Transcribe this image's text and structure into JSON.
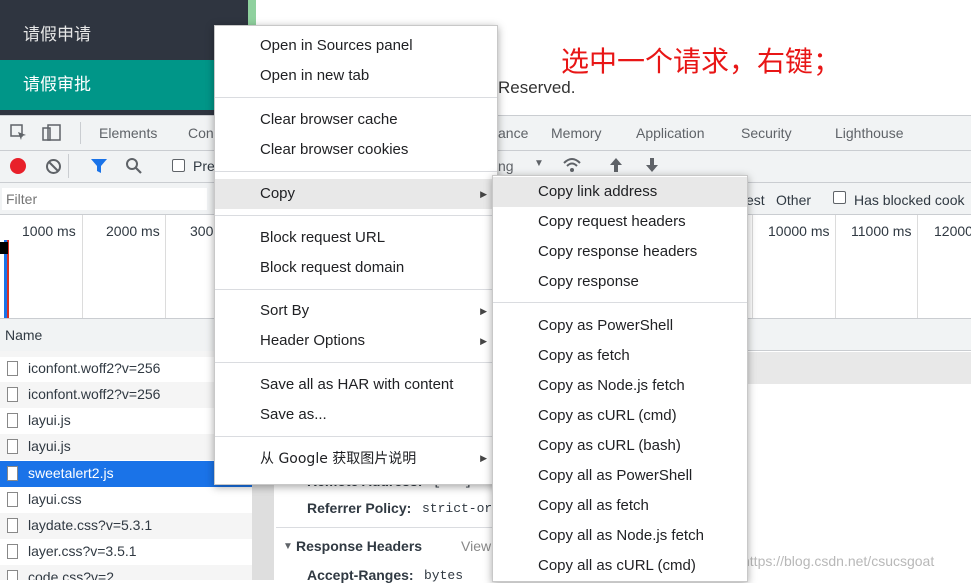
{
  "webpage": {
    "nav_items": [
      "请假申请",
      "请假审批"
    ],
    "footer_text": "Reserved.",
    "annotation": "选中一个请求，右键；"
  },
  "devtools": {
    "tabs": [
      "Elements",
      "Con",
      "ance",
      "Memory",
      "Application",
      "Security",
      "Lighthouse"
    ],
    "preserve_label": "Pre",
    "throttle_label": "ng",
    "filter_placeholder": "Filter",
    "filter_types": [
      "est",
      "Other"
    ],
    "blocked_label": "Has blocked cook",
    "timeline_ticks": [
      "1000 ms",
      "2000 ms",
      "300",
      "10000 ms",
      "11000 ms",
      "12000"
    ],
    "name_header": "Name",
    "requests": [
      {
        "name": "iconfont.woff2?v=256"
      },
      {
        "name": "iconfont.woff2?v=256"
      },
      {
        "name": "layui.js"
      },
      {
        "name": "layui.js"
      },
      {
        "name": "sweetalert2.js"
      },
      {
        "name": "layui.css"
      },
      {
        "name": "laydate.css?v=5.3.1"
      },
      {
        "name": "layer.css?v=3.5.1"
      },
      {
        "name": "code.css?v=2"
      }
    ],
    "detail": {
      "remote_address_label": "Remote Address:",
      "remote_address_value": "[::1]:8",
      "referrer_label": "Referrer Policy:",
      "referrer_value": "strict-or",
      "response_headers_label": "Response Headers",
      "view_label": "View",
      "accept_ranges_label": "Accept-Ranges:",
      "accept_ranges_value": "bytes"
    }
  },
  "context_menu": {
    "group1": [
      "Open in Sources panel",
      "Open in new tab"
    ],
    "group2": [
      "Clear browser cache",
      "Clear browser cookies"
    ],
    "copy": "Copy",
    "group3": [
      "Block request URL",
      "Block request domain"
    ],
    "sort_by": "Sort By",
    "header_options": "Header Options",
    "group5": [
      "Save all as HAR with content",
      "Save as..."
    ],
    "google": "从 Google 获取图片说明"
  },
  "copy_submenu": {
    "group1": [
      "Copy link address",
      "Copy request headers",
      "Copy response headers",
      "Copy response"
    ],
    "group2": [
      "Copy as PowerShell",
      "Copy as fetch",
      "Copy as Node.js fetch",
      "Copy as cURL (cmd)",
      "Copy as cURL (bash)",
      "Copy all as PowerShell",
      "Copy all as fetch",
      "Copy all as Node.js fetch",
      "Copy all as cURL (cmd)"
    ]
  },
  "watermark": "https://blog.csdn.net/csucsgoat",
  "colors": {
    "nav_dark": "#2f3540",
    "nav_active": "#009688",
    "annotation": "#e81616",
    "selection": "#1a73e8",
    "record": "#e8202a"
  }
}
